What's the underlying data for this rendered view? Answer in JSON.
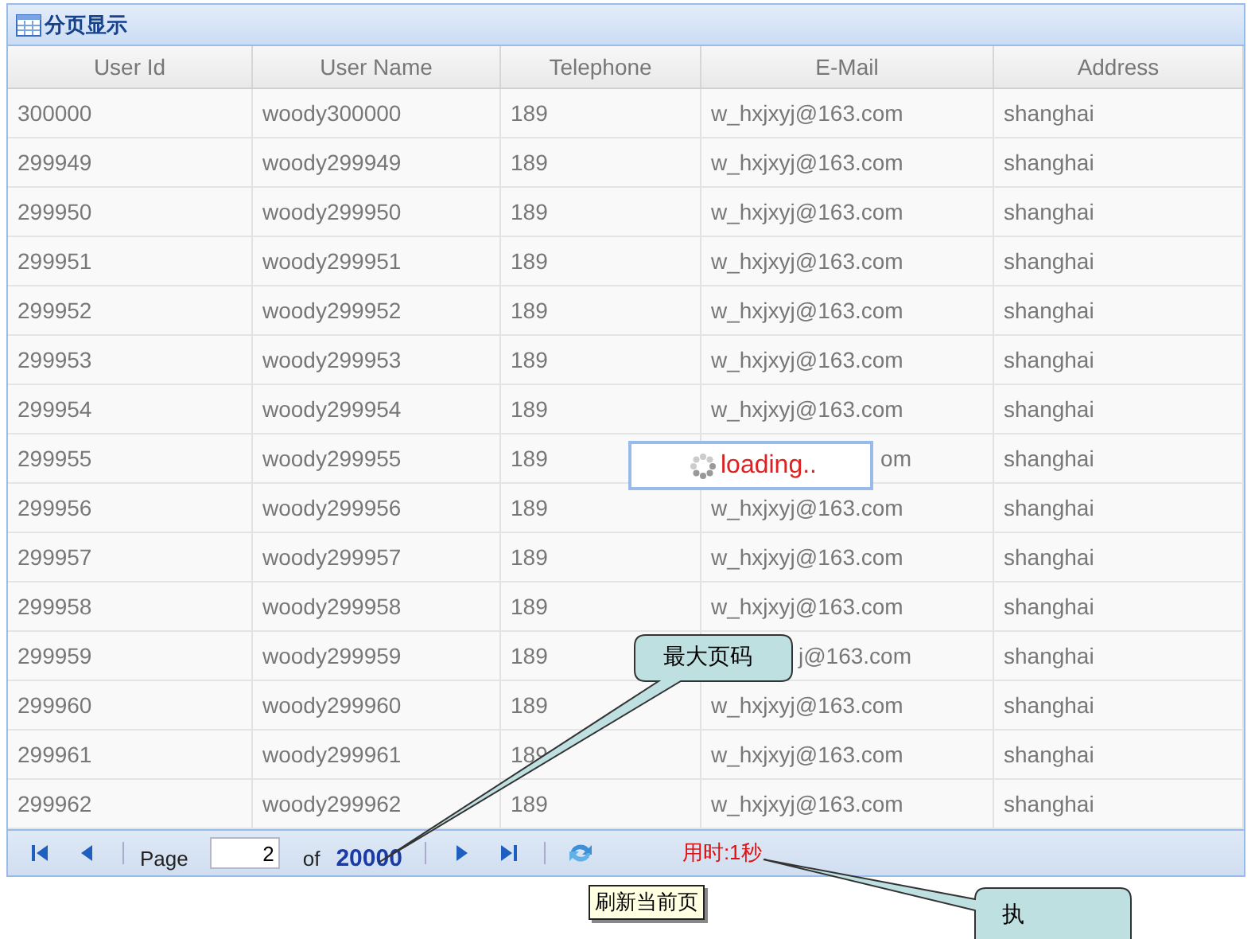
{
  "panel": {
    "title": "分页显示"
  },
  "columns": [
    "User Id",
    "User Name",
    "Telephone",
    "E-Mail",
    "Address"
  ],
  "rows": [
    {
      "cells": [
        "300000",
        "woody300000",
        "189",
        "w_hxjxyj@163.com",
        "shanghai"
      ]
    },
    {
      "cells": [
        "299949",
        "woody299949",
        "189",
        "w_hxjxyj@163.com",
        "shanghai"
      ]
    },
    {
      "cells": [
        "299950",
        "woody299950",
        "189",
        "w_hxjxyj@163.com",
        "shanghai"
      ]
    },
    {
      "cells": [
        "299951",
        "woody299951",
        "189",
        "w_hxjxyj@163.com",
        "shanghai"
      ]
    },
    {
      "cells": [
        "299952",
        "woody299952",
        "189",
        "w_hxjxyj@163.com",
        "shanghai"
      ]
    },
    {
      "cells": [
        "299953",
        "woody299953",
        "189",
        "w_hxjxyj@163.com",
        "shanghai"
      ]
    },
    {
      "cells": [
        "299954",
        "woody299954",
        "189",
        "w_hxjxyj@163.com",
        "shanghai"
      ]
    },
    {
      "cells": [
        "299955",
        "woody299955",
        "189",
        {
          "text": "om",
          "kind": "partial"
        },
        "shanghai"
      ]
    },
    {
      "cells": [
        "299956",
        "woody299956",
        "189",
        "w_hxjxyj@163.com",
        "shanghai"
      ]
    },
    {
      "cells": [
        "299957",
        "woody299957",
        "189",
        "w_hxjxyj@163.com",
        "shanghai"
      ]
    },
    {
      "cells": [
        "299958",
        "woody299958",
        "189",
        "w_hxjxyj@163.com",
        "shanghai"
      ]
    },
    {
      "cells": [
        "299959",
        "woody299959",
        "189",
        {
          "text": "j@163.com",
          "kind": "partial"
        },
        "shanghai"
      ]
    },
    {
      "cells": [
        "299960",
        "woody299960",
        "189",
        "w_hxjxyj@163.com",
        "shanghai"
      ]
    },
    {
      "cells": [
        "299961",
        "woody299961",
        "189",
        "w_hxjxyj@163.com",
        "shanghai"
      ]
    },
    {
      "cells": [
        "299962",
        "woody299962",
        "189",
        "w_hxjxyj@163.com",
        "shanghai"
      ]
    }
  ],
  "pager": {
    "page_label": "Page",
    "page_value": "2",
    "of_label": "of",
    "total_pages": "20000",
    "elapsed": "用时:1秒"
  },
  "loading": {
    "text": "loading.."
  },
  "tooltip": {
    "text": "刷新当前页"
  },
  "callouts": [
    {
      "text": "最大页码"
    },
    {
      "text": "执"
    }
  ]
}
